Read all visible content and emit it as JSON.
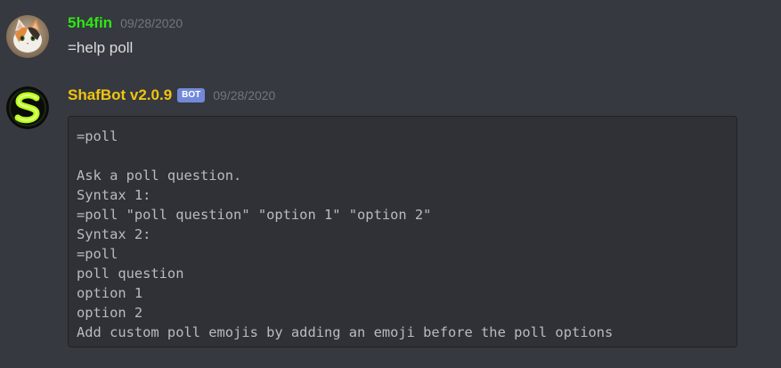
{
  "messages": [
    {
      "author": "5h4fin",
      "author_color": "#2ee615",
      "timestamp": "09/28/2020",
      "avatar": "cat-avatar",
      "text": "=help poll"
    },
    {
      "author": "ShafBot v2.0.9",
      "author_color": "#f1c40f",
      "bot_tag": "BOT",
      "timestamp": "09/28/2020",
      "avatar": "bot-s-logo-avatar",
      "code_lines": [
        "=poll",
        "",
        "Ask a poll question.",
        "Syntax 1:",
        "=poll \"poll question\" \"option 1\" \"option 2\"",
        "Syntax 2:",
        "=poll",
        "poll question",
        "option 1",
        "option 2",
        "Add custom poll emojis by adding an emoji before the poll options"
      ]
    }
  ],
  "colors": {
    "background": "#36393f",
    "code_background": "#2f3136",
    "timestamp": "#72767d",
    "bot_tag": "#7289da"
  }
}
